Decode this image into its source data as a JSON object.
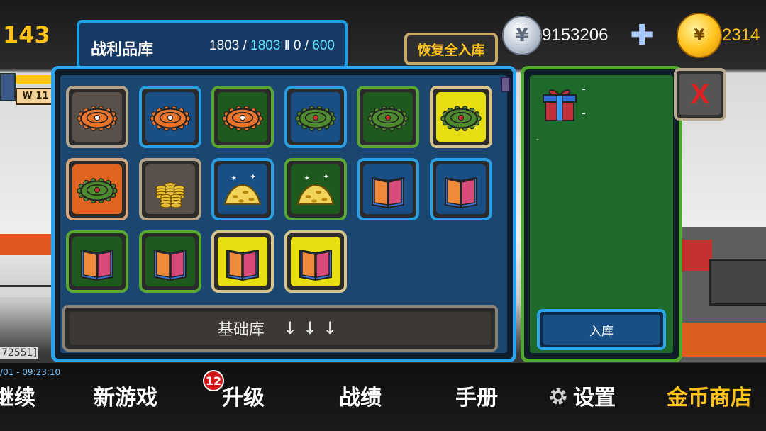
{
  "hud": {
    "score": "143",
    "silver_symbol": "¥",
    "silver_value": "9153206",
    "plus": "✚",
    "gold_symbol": "¥",
    "gold_value": "2314",
    "left_badge": "W 11",
    "coord_text": "72551]"
  },
  "loot": {
    "title": "战利品库",
    "count_current": "1803",
    "count_cap": "1803",
    "count_sep": "‖",
    "count_extra": "0",
    "count_limit": "600",
    "restore_button": "恢复全入库",
    "base_button": "基础库",
    "arrows": "↓↓↓"
  },
  "items": [
    {
      "type": "bottlecap-orange",
      "rarity": "gray"
    },
    {
      "type": "bottlecap-orange",
      "rarity": "blue"
    },
    {
      "type": "bottlecap-orange",
      "rarity": "green"
    },
    {
      "type": "bottlecap-green",
      "rarity": "blue"
    },
    {
      "type": "bottlecap-green",
      "rarity": "green"
    },
    {
      "type": "bottlecap-green",
      "rarity": "yellow"
    },
    {
      "type": "bottlecap-green",
      "rarity": "orange"
    },
    {
      "type": "coin-stacks",
      "rarity": "gray"
    },
    {
      "type": "gold-pile",
      "rarity": "blue"
    },
    {
      "type": "gold-pile",
      "rarity": "green"
    },
    {
      "type": "book",
      "rarity": "blue"
    },
    {
      "type": "book",
      "rarity": "blue"
    },
    {
      "type": "book",
      "rarity": "green"
    },
    {
      "type": "book",
      "rarity": "green"
    },
    {
      "type": "book",
      "rarity": "yellow"
    },
    {
      "type": "book",
      "rarity": "yellow"
    }
  ],
  "side": {
    "dash_1": "-",
    "dash_2": "-",
    "dash_3": "-",
    "store_button": "入库",
    "close": "X"
  },
  "bottom": {
    "timestamp": "/01 - 09:23:10",
    "nav_continue": "继续",
    "nav_new_game": "新游戏",
    "nav_upgrade": "升级",
    "upgrade_badge": "12",
    "nav_records": "战绩",
    "nav_manual": "手册",
    "nav_settings": "设置",
    "nav_gold_shop": "金币商店"
  },
  "colors": {
    "accent_gold": "#ffc21b",
    "panel_blue": "#2aa4ec",
    "panel_green": "#52a82e",
    "close_red": "#e02020"
  }
}
